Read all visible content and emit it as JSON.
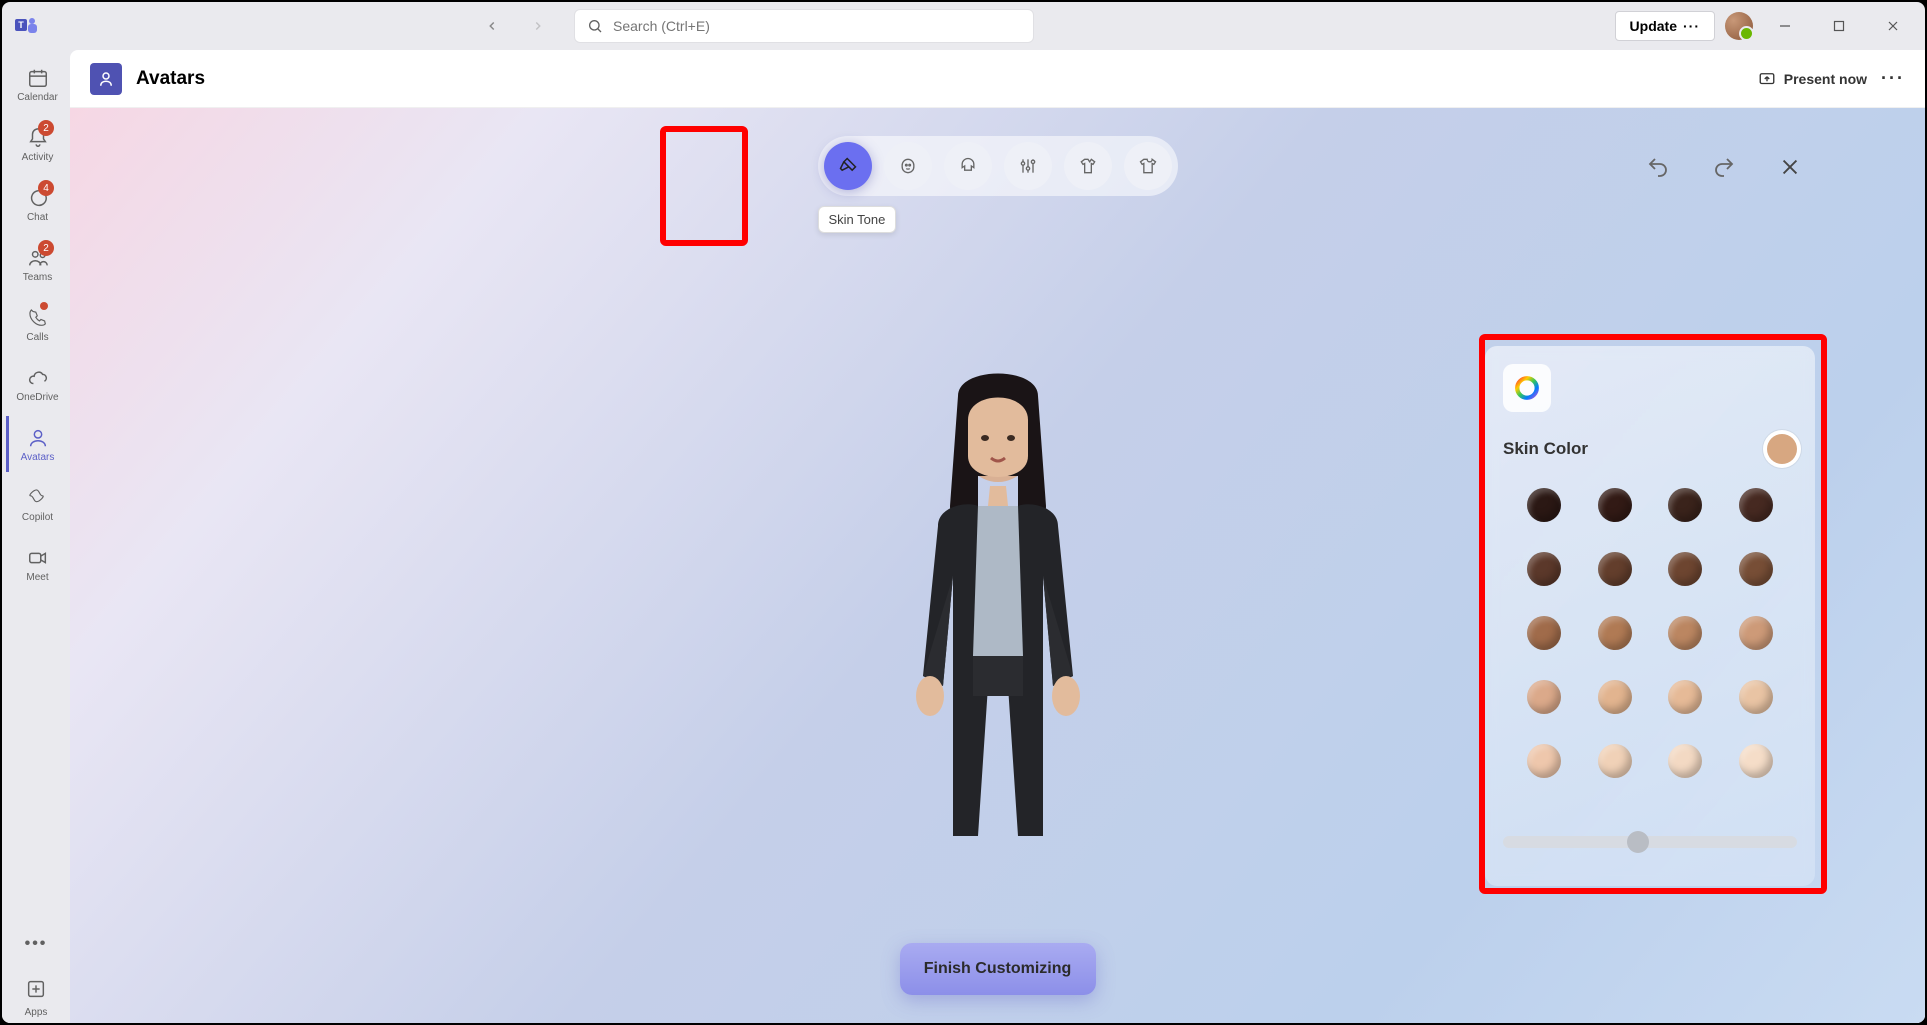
{
  "titlebar": {
    "search_placeholder": "Search (Ctrl+E)",
    "update_label": "Update"
  },
  "rail": {
    "items": [
      {
        "id": "calendar",
        "label": "Calendar"
      },
      {
        "id": "activity",
        "label": "Activity",
        "badge": "2"
      },
      {
        "id": "chat",
        "label": "Chat",
        "badge": "4"
      },
      {
        "id": "teams",
        "label": "Teams",
        "badge": "2"
      },
      {
        "id": "calls",
        "label": "Calls",
        "badge_dot": true
      },
      {
        "id": "onedrive",
        "label": "OneDrive"
      },
      {
        "id": "avatars",
        "label": "Avatars",
        "active": true
      },
      {
        "id": "copilot",
        "label": "Copilot"
      },
      {
        "id": "meet",
        "label": "Meet"
      }
    ],
    "apps_label": "Apps"
  },
  "page": {
    "title": "Avatars",
    "present_label": "Present now"
  },
  "categories": {
    "tooltip": "Skin Tone",
    "items": [
      {
        "id": "skin-tone",
        "icon": "brush",
        "active": true
      },
      {
        "id": "face",
        "icon": "face"
      },
      {
        "id": "hair",
        "icon": "hair"
      },
      {
        "id": "body",
        "icon": "sliders"
      },
      {
        "id": "outfit",
        "icon": "shirt"
      },
      {
        "id": "wardrobe",
        "icon": "tshirt"
      }
    ]
  },
  "actions": {
    "finish_label": "Finish Customizing"
  },
  "skin_panel": {
    "title": "Skin Color",
    "selected_color": "#d7a781",
    "swatches": [
      "#2b1814",
      "#321a15",
      "#3a231b",
      "#462921",
      "#5b382a",
      "#633e2c",
      "#6d4530",
      "#774e36",
      "#a06b4a",
      "#b07a54",
      "#bb8661",
      "#cd9a78",
      "#dba98a",
      "#e2b48f",
      "#e6ba97",
      "#e9c4a4",
      "#eec7ac",
      "#f0d1b7",
      "#f3d9c3",
      "#f5ddc8"
    ],
    "slider_value": 0.46
  }
}
